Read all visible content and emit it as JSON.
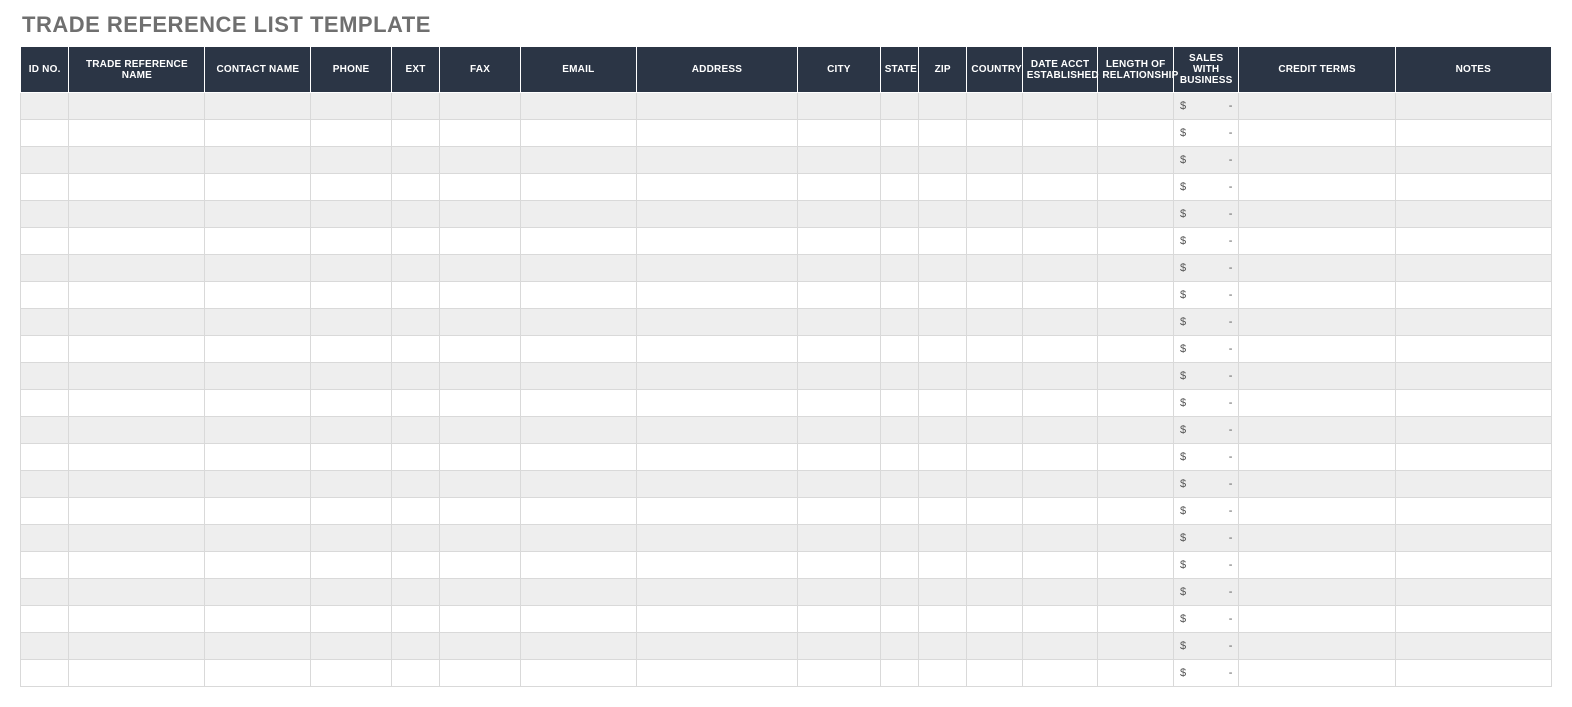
{
  "title": "TRADE REFERENCE LIST TEMPLATE",
  "columns": [
    "ID NO.",
    "TRADE REFERENCE NAME",
    "CONTACT NAME",
    "PHONE",
    "EXT",
    "FAX",
    "EMAIL",
    "ADDRESS",
    "CITY",
    "STATE",
    "ZIP",
    "COUNTRY",
    "DATE ACCT ESTABLISHED",
    "LENGTH OF RELATIONSHIP",
    "SALES WITH BUSINESS",
    "CREDIT TERMS",
    "NOTES"
  ],
  "sales_currency_symbol": "$",
  "sales_empty_value": "-",
  "rows": [
    {
      "id_no": "",
      "trade_reference_name": "",
      "contact_name": "",
      "phone": "",
      "ext": "",
      "fax": "",
      "email": "",
      "address": "",
      "city": "",
      "state": "",
      "zip": "",
      "country": "",
      "date_acct_established": "",
      "length_of_relationship": "",
      "sales_with_business": "-",
      "credit_terms": "",
      "notes": ""
    },
    {
      "id_no": "",
      "trade_reference_name": "",
      "contact_name": "",
      "phone": "",
      "ext": "",
      "fax": "",
      "email": "",
      "address": "",
      "city": "",
      "state": "",
      "zip": "",
      "country": "",
      "date_acct_established": "",
      "length_of_relationship": "",
      "sales_with_business": "-",
      "credit_terms": "",
      "notes": ""
    },
    {
      "id_no": "",
      "trade_reference_name": "",
      "contact_name": "",
      "phone": "",
      "ext": "",
      "fax": "",
      "email": "",
      "address": "",
      "city": "",
      "state": "",
      "zip": "",
      "country": "",
      "date_acct_established": "",
      "length_of_relationship": "",
      "sales_with_business": "-",
      "credit_terms": "",
      "notes": ""
    },
    {
      "id_no": "",
      "trade_reference_name": "",
      "contact_name": "",
      "phone": "",
      "ext": "",
      "fax": "",
      "email": "",
      "address": "",
      "city": "",
      "state": "",
      "zip": "",
      "country": "",
      "date_acct_established": "",
      "length_of_relationship": "",
      "sales_with_business": "-",
      "credit_terms": "",
      "notes": ""
    },
    {
      "id_no": "",
      "trade_reference_name": "",
      "contact_name": "",
      "phone": "",
      "ext": "",
      "fax": "",
      "email": "",
      "address": "",
      "city": "",
      "state": "",
      "zip": "",
      "country": "",
      "date_acct_established": "",
      "length_of_relationship": "",
      "sales_with_business": "-",
      "credit_terms": "",
      "notes": ""
    },
    {
      "id_no": "",
      "trade_reference_name": "",
      "contact_name": "",
      "phone": "",
      "ext": "",
      "fax": "",
      "email": "",
      "address": "",
      "city": "",
      "state": "",
      "zip": "",
      "country": "",
      "date_acct_established": "",
      "length_of_relationship": "",
      "sales_with_business": "-",
      "credit_terms": "",
      "notes": ""
    },
    {
      "id_no": "",
      "trade_reference_name": "",
      "contact_name": "",
      "phone": "",
      "ext": "",
      "fax": "",
      "email": "",
      "address": "",
      "city": "",
      "state": "",
      "zip": "",
      "country": "",
      "date_acct_established": "",
      "length_of_relationship": "",
      "sales_with_business": "-",
      "credit_terms": "",
      "notes": ""
    },
    {
      "id_no": "",
      "trade_reference_name": "",
      "contact_name": "",
      "phone": "",
      "ext": "",
      "fax": "",
      "email": "",
      "address": "",
      "city": "",
      "state": "",
      "zip": "",
      "country": "",
      "date_acct_established": "",
      "length_of_relationship": "",
      "sales_with_business": "-",
      "credit_terms": "",
      "notes": ""
    },
    {
      "id_no": "",
      "trade_reference_name": "",
      "contact_name": "",
      "phone": "",
      "ext": "",
      "fax": "",
      "email": "",
      "address": "",
      "city": "",
      "state": "",
      "zip": "",
      "country": "",
      "date_acct_established": "",
      "length_of_relationship": "",
      "sales_with_business": "-",
      "credit_terms": "",
      "notes": ""
    },
    {
      "id_no": "",
      "trade_reference_name": "",
      "contact_name": "",
      "phone": "",
      "ext": "",
      "fax": "",
      "email": "",
      "address": "",
      "city": "",
      "state": "",
      "zip": "",
      "country": "",
      "date_acct_established": "",
      "length_of_relationship": "",
      "sales_with_business": "-",
      "credit_terms": "",
      "notes": ""
    },
    {
      "id_no": "",
      "trade_reference_name": "",
      "contact_name": "",
      "phone": "",
      "ext": "",
      "fax": "",
      "email": "",
      "address": "",
      "city": "",
      "state": "",
      "zip": "",
      "country": "",
      "date_acct_established": "",
      "length_of_relationship": "",
      "sales_with_business": "-",
      "credit_terms": "",
      "notes": ""
    },
    {
      "id_no": "",
      "trade_reference_name": "",
      "contact_name": "",
      "phone": "",
      "ext": "",
      "fax": "",
      "email": "",
      "address": "",
      "city": "",
      "state": "",
      "zip": "",
      "country": "",
      "date_acct_established": "",
      "length_of_relationship": "",
      "sales_with_business": "-",
      "credit_terms": "",
      "notes": ""
    },
    {
      "id_no": "",
      "trade_reference_name": "",
      "contact_name": "",
      "phone": "",
      "ext": "",
      "fax": "",
      "email": "",
      "address": "",
      "city": "",
      "state": "",
      "zip": "",
      "country": "",
      "date_acct_established": "",
      "length_of_relationship": "",
      "sales_with_business": "-",
      "credit_terms": "",
      "notes": ""
    },
    {
      "id_no": "",
      "trade_reference_name": "",
      "contact_name": "",
      "phone": "",
      "ext": "",
      "fax": "",
      "email": "",
      "address": "",
      "city": "",
      "state": "",
      "zip": "",
      "country": "",
      "date_acct_established": "",
      "length_of_relationship": "",
      "sales_with_business": "-",
      "credit_terms": "",
      "notes": ""
    },
    {
      "id_no": "",
      "trade_reference_name": "",
      "contact_name": "",
      "phone": "",
      "ext": "",
      "fax": "",
      "email": "",
      "address": "",
      "city": "",
      "state": "",
      "zip": "",
      "country": "",
      "date_acct_established": "",
      "length_of_relationship": "",
      "sales_with_business": "-",
      "credit_terms": "",
      "notes": ""
    },
    {
      "id_no": "",
      "trade_reference_name": "",
      "contact_name": "",
      "phone": "",
      "ext": "",
      "fax": "",
      "email": "",
      "address": "",
      "city": "",
      "state": "",
      "zip": "",
      "country": "",
      "date_acct_established": "",
      "length_of_relationship": "",
      "sales_with_business": "-",
      "credit_terms": "",
      "notes": ""
    },
    {
      "id_no": "",
      "trade_reference_name": "",
      "contact_name": "",
      "phone": "",
      "ext": "",
      "fax": "",
      "email": "",
      "address": "",
      "city": "",
      "state": "",
      "zip": "",
      "country": "",
      "date_acct_established": "",
      "length_of_relationship": "",
      "sales_with_business": "-",
      "credit_terms": "",
      "notes": ""
    },
    {
      "id_no": "",
      "trade_reference_name": "",
      "contact_name": "",
      "phone": "",
      "ext": "",
      "fax": "",
      "email": "",
      "address": "",
      "city": "",
      "state": "",
      "zip": "",
      "country": "",
      "date_acct_established": "",
      "length_of_relationship": "",
      "sales_with_business": "-",
      "credit_terms": "",
      "notes": ""
    },
    {
      "id_no": "",
      "trade_reference_name": "",
      "contact_name": "",
      "phone": "",
      "ext": "",
      "fax": "",
      "email": "",
      "address": "",
      "city": "",
      "state": "",
      "zip": "",
      "country": "",
      "date_acct_established": "",
      "length_of_relationship": "",
      "sales_with_business": "-",
      "credit_terms": "",
      "notes": ""
    },
    {
      "id_no": "",
      "trade_reference_name": "",
      "contact_name": "",
      "phone": "",
      "ext": "",
      "fax": "",
      "email": "",
      "address": "",
      "city": "",
      "state": "",
      "zip": "",
      "country": "",
      "date_acct_established": "",
      "length_of_relationship": "",
      "sales_with_business": "-",
      "credit_terms": "",
      "notes": ""
    },
    {
      "id_no": "",
      "trade_reference_name": "",
      "contact_name": "",
      "phone": "",
      "ext": "",
      "fax": "",
      "email": "",
      "address": "",
      "city": "",
      "state": "",
      "zip": "",
      "country": "",
      "date_acct_established": "",
      "length_of_relationship": "",
      "sales_with_business": "-",
      "credit_terms": "",
      "notes": ""
    },
    {
      "id_no": "",
      "trade_reference_name": "",
      "contact_name": "",
      "phone": "",
      "ext": "",
      "fax": "",
      "email": "",
      "address": "",
      "city": "",
      "state": "",
      "zip": "",
      "country": "",
      "date_acct_established": "",
      "length_of_relationship": "",
      "sales_with_business": "-",
      "credit_terms": "",
      "notes": ""
    }
  ]
}
